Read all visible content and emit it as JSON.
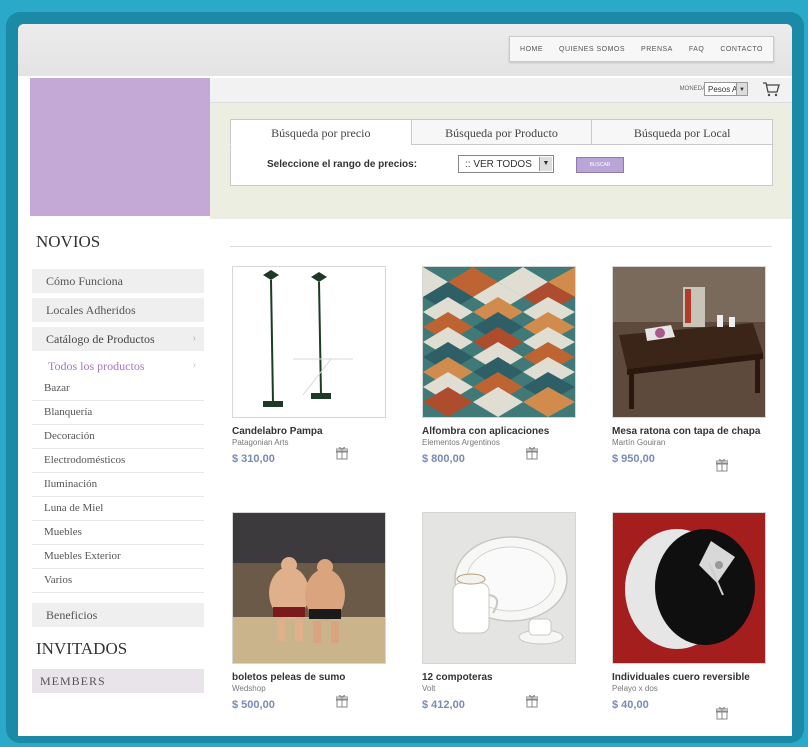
{
  "topnav": {
    "items": [
      "Home",
      "Quienes somos",
      "Prensa",
      "FAQ",
      "Contacto"
    ]
  },
  "currency": {
    "label": "Moneda",
    "selected": "Pesos Arg"
  },
  "sidebar": {
    "novios_title": "NOVIOS",
    "items": [
      {
        "label": "Cómo Funciona"
      },
      {
        "label": "Locales Adheridos"
      },
      {
        "label": "Catálogo de Productos"
      }
    ],
    "todos_label": "Todos los productos",
    "categories": [
      "Bazar",
      "Blanquería",
      "Decoración",
      "Electrodomésticos",
      "Iluminación",
      "Luna de Miel",
      "Muebles",
      "Muebles Exterior",
      "Varios"
    ],
    "beneficios": "Beneficios",
    "invitados_title": "INVITADOS",
    "members_label": "MEMBERS"
  },
  "search": {
    "tabs": [
      "Búsqueda por precio",
      "Búsqueda por Producto",
      "Búsqueda por Local"
    ],
    "active_tab": 0,
    "range_label": "Seleccione el rango de precios:",
    "range_value": ":: VER TODOS",
    "button_label": "Buscar"
  },
  "products": [
    {
      "name": "Candelabro Pampa",
      "seller": "Patagonian Arts",
      "price": "$ 310,00",
      "image": "candelabra"
    },
    {
      "name": "Alfombra con aplicaciones",
      "seller": "Elementos Argentinos",
      "price": "$ 800,00",
      "image": "rug"
    },
    {
      "name": "Mesa ratona con tapa de chapa",
      "seller": "Martín Gouiran",
      "price": "$ 950,00",
      "image": "coffee-table"
    },
    {
      "name": "boletos peleas de sumo",
      "seller": "Wedshop",
      "price": "$ 500,00",
      "image": "sumo"
    },
    {
      "name": "12 compoteras",
      "seller": "Volt",
      "price": "$ 412,00",
      "image": "china"
    },
    {
      "name": "Individuales cuero reversible",
      "seller": "Pelayo x dos",
      "price": "$ 40,00",
      "image": "placemats"
    }
  ],
  "colors": {
    "accent_purple": "#c4a9d6",
    "frame_teal": "#2aa9c9",
    "price_blue": "#7a8ab8"
  }
}
